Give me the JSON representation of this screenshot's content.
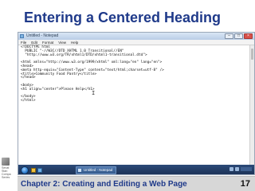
{
  "slide": {
    "title": "Entering a Centered Heading",
    "footer": "Chapter 2: Creating and Editing a Web Page",
    "page_number": "17"
  },
  "logo": {
    "lines": [
      "Senat",
      "Stan",
      "Compa",
      "Series"
    ]
  },
  "notepad": {
    "window_title": "Untitled - Notepad",
    "menu": [
      "File",
      "Edit",
      "Format",
      "View",
      "Help"
    ],
    "code_lines": [
      "<!DOCTYPE html",
      "  PUBLIC \"-//W3C//DTD XHTML 1.0 Transitional//EN\"",
      "  \"http://www.w3.org/TR/xhtml1/DTD/xhtml1-transitional.dtd\">",
      "",
      "<html xmlns=\"http://www.w3.org/1999/xhtml\" xml:lang=\"en\" lang=\"en\">",
      "<head>",
      "<meta http-equiv=\"Content-Type\" content=\"text/html;charset=utf-8\" />",
      "<title>Community Food Pantry</title>",
      "</head>",
      "",
      "<body>",
      "<h1 align=\"center\">Please Help</h1>",
      "",
      "</body>",
      "</html>"
    ],
    "cursor": "I"
  },
  "taskbar": {
    "task_label": "Untitled - Notepad"
  },
  "icons": {
    "start": "windows-start-orb",
    "quick_launch": [
      "folder-icon",
      "ie-icon"
    ],
    "tray": [
      "network-icon",
      "volume-icon",
      "clock"
    ],
    "window_controls": [
      "minimize-icon",
      "maximize-icon",
      "close-icon"
    ]
  },
  "colors": {
    "title": "#1f3a8a",
    "footer_bg": "#d7d7d7",
    "taskbar": "#1a2f52"
  }
}
